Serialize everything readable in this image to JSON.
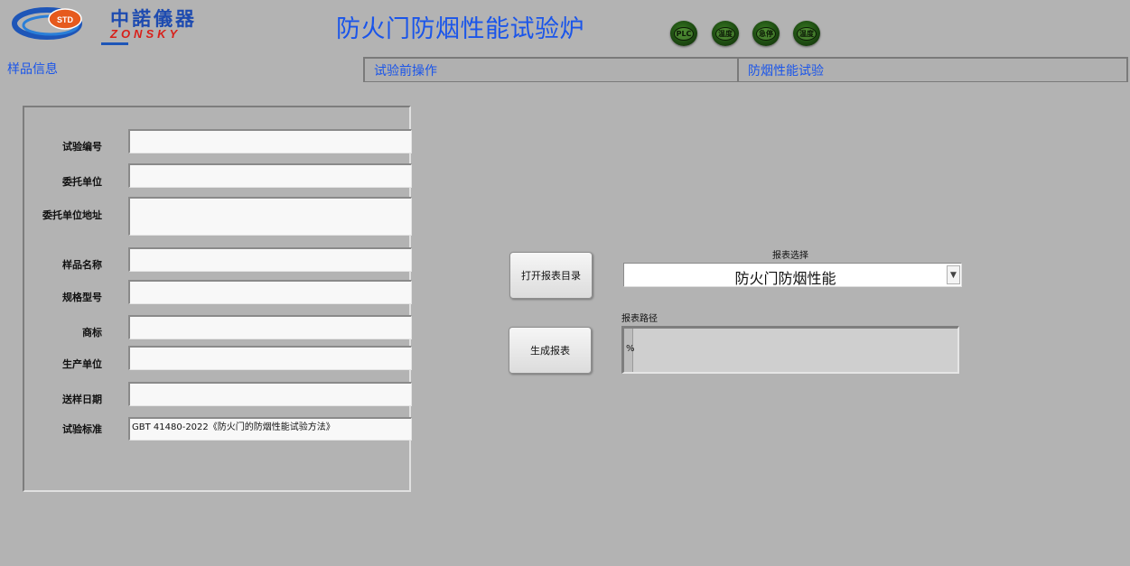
{
  "header": {
    "logo": {
      "badge": "STD",
      "company_cn": "中諾儀器",
      "company_en": "ZONSKY"
    },
    "title": "防火门防烟性能试验炉",
    "indicators": [
      {
        "label": "PLC"
      },
      {
        "label": "温度"
      },
      {
        "label": "急停"
      },
      {
        "label": "温度"
      }
    ]
  },
  "tabs": [
    {
      "label": "样品信息",
      "active": true
    },
    {
      "label": "试验前操作",
      "active": false
    },
    {
      "label": "防烟性能试验",
      "active": false
    }
  ],
  "sample_info": {
    "fields": [
      {
        "label": "试验编号",
        "value": ""
      },
      {
        "label": "委托单位",
        "value": ""
      },
      {
        "label": "委托单位地址",
        "value": ""
      },
      {
        "label": "样品名称",
        "value": ""
      },
      {
        "label": "规格型号",
        "value": ""
      },
      {
        "label": "商标",
        "value": ""
      },
      {
        "label": "生产单位",
        "value": ""
      },
      {
        "label": "送样日期",
        "value": ""
      },
      {
        "label": "试验标准",
        "value": "GBT 41480-2022《防火门的防烟性能试验方法》"
      }
    ]
  },
  "report": {
    "open_dir_label": "打开报表目录",
    "generate_label": "生成报表",
    "select_label": "报表选择",
    "select_value": "防火门防烟性能",
    "path_label": "报表路径",
    "path_value": "%"
  },
  "colors": {
    "accent": "#1a55ea",
    "background": "#b3b3b3",
    "led_green": "#2e6a1c"
  }
}
